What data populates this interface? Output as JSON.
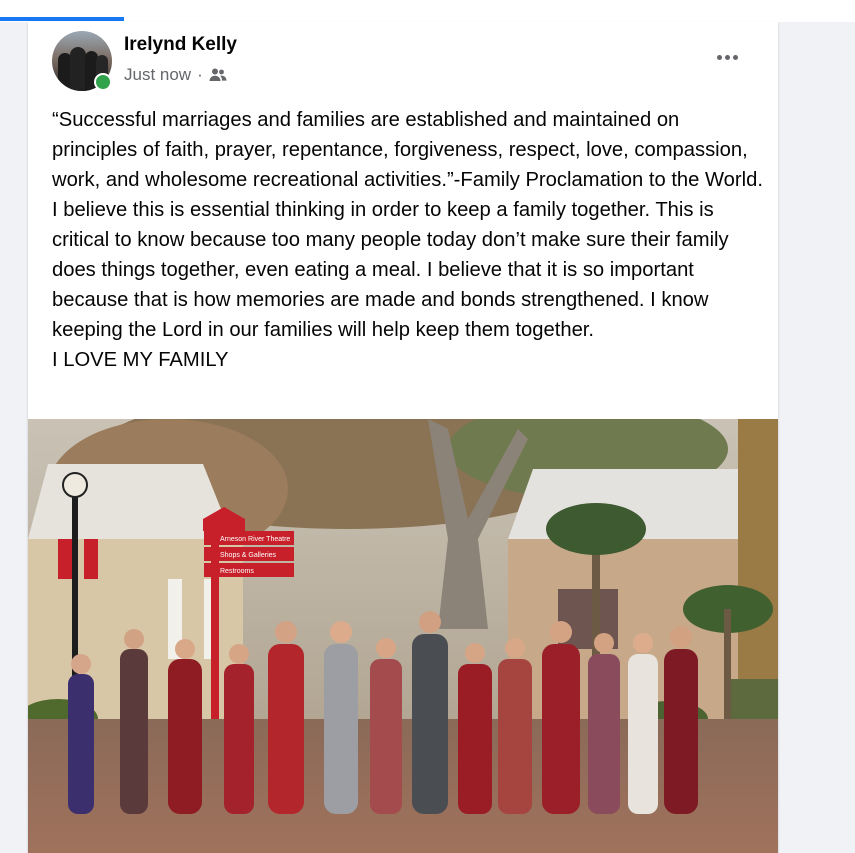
{
  "post": {
    "author": "Irelynd Kelly",
    "timestamp": "Just now",
    "separator": "·",
    "audience_icon": "friends-icon",
    "more_icon": "more-horizontal-icon",
    "body": "“Successful marriages and families are established and maintained on principles of faith, prayer, repentance, forgiveness, respect, love, compassion, work, and wholesome recreational activities.”-Family Proclamation to the World. I believe this is essential thinking in order to keep a family together. This is critical to know because too many people today don’t make sure their family does things together, even eating a meal. I believe that it is so important because that is how memories are made and bonds strengthened. I know keeping the Lord in our families will help keep them together.\nI LOVE MY FAMILY"
  },
  "photo": {
    "sign_lines": [
      "Arneson River Theatre",
      "Shops & Galleries",
      "Restrooms"
    ]
  },
  "colors": {
    "accent": "#1877f2",
    "online": "#31a24c",
    "secondary_text": "#65676b"
  }
}
